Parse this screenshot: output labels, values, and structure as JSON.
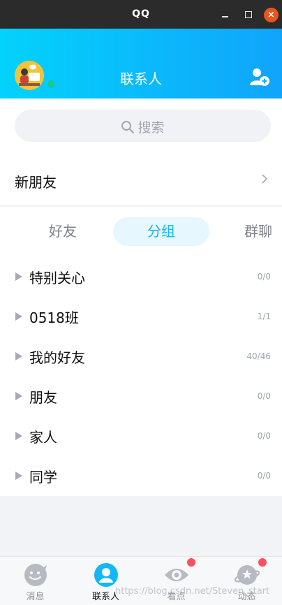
{
  "window": {
    "title": "QQ",
    "close_glyph": "×"
  },
  "header": {
    "title": "联系人",
    "avatar_icon": "user-avatar",
    "add_icon": "add-friend-icon",
    "accent": "#12b7f5"
  },
  "search": {
    "placeholder": "搜索"
  },
  "new_friends": {
    "label": "新朋友"
  },
  "tabs": [
    {
      "label": "好友"
    },
    {
      "label": "分组"
    },
    {
      "label": "群聊"
    }
  ],
  "active_tab": "分组",
  "groups": [
    {
      "name": "特别关心",
      "count": "0/0"
    },
    {
      "name": "0518班",
      "count": "1/1"
    },
    {
      "name": "我的好友",
      "count": "40/46"
    },
    {
      "name": "朋友",
      "count": "0/0"
    },
    {
      "name": "家人",
      "count": "0/0"
    },
    {
      "name": "同学",
      "count": "0/0"
    }
  ],
  "bottom_nav": [
    {
      "label": "消息",
      "icon": "message-icon"
    },
    {
      "label": "联系人",
      "icon": "contacts-icon"
    },
    {
      "label": "看点",
      "icon": "eye-icon"
    },
    {
      "label": "动态",
      "icon": "planet-icon"
    }
  ],
  "watermark": "https://blog.csdn.net/Steven_start"
}
